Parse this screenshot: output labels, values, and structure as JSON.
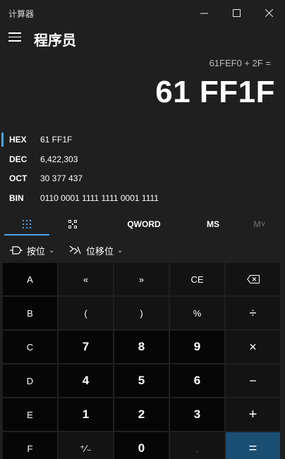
{
  "window": {
    "app_title": "计算器"
  },
  "header": {
    "mode_title": "程序员"
  },
  "display": {
    "expression": "61FEF0 + 2F =",
    "result": "61 FF1F"
  },
  "radix": [
    {
      "label": "HEX",
      "value": "61 FF1F",
      "selected": true
    },
    {
      "label": "DEC",
      "value": "6,422,303"
    },
    {
      "label": "OCT",
      "value": "30 377 437"
    },
    {
      "label": "BIN",
      "value": "0110 0001 1111 1111 0001 1111"
    }
  ],
  "tabs": {
    "word_size": "QWORD",
    "memory_store": "MS",
    "memory_list": "M˅"
  },
  "operations": {
    "bitwise": "按位",
    "bit_shift": "位移位"
  },
  "keys": {
    "A": "A",
    "lshift": "«",
    "rshift": "»",
    "CE": "CE",
    "B": "B",
    "lparen": "(",
    "rparen": ")",
    "mod": "%",
    "div": "÷",
    "C": "C",
    "n7": "7",
    "n8": "8",
    "n9": "9",
    "mul": "×",
    "D": "D",
    "n4": "4",
    "n5": "5",
    "n6": "6",
    "sub": "−",
    "E": "E",
    "n1": "1",
    "n2": "2",
    "n3": "3",
    "add": "+",
    "F": "F",
    "negate": "⁺∕₋",
    "n0": "0",
    "decimal": ".",
    "equals": "="
  },
  "colors": {
    "accent": "#4aa3f0",
    "equals_bg": "#1b4e73",
    "background": "#1f1f1f"
  }
}
